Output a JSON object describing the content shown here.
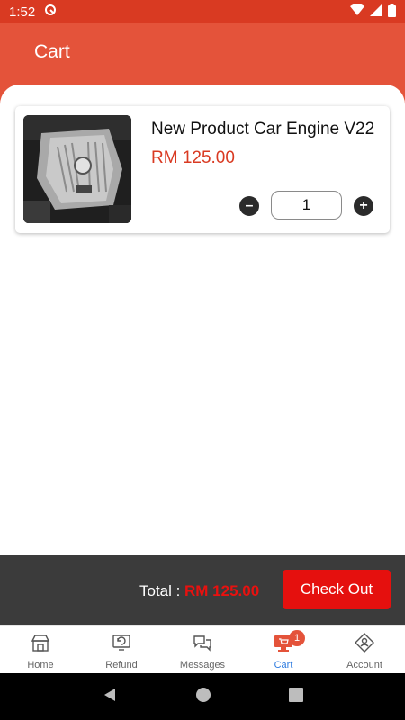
{
  "status_bar": {
    "time": "1:52"
  },
  "header": {
    "title": "Cart"
  },
  "cart": {
    "items": [
      {
        "name": "New Product Car Engine V22",
        "price": "RM 125.00",
        "quantity": "1"
      }
    ]
  },
  "checkout": {
    "total_label": "Total :",
    "total_value": "RM 125.00",
    "button_label": "Check Out"
  },
  "bottom_nav": {
    "items": [
      {
        "label": "Home",
        "icon": "store-icon"
      },
      {
        "label": "Refund",
        "icon": "refund-icon"
      },
      {
        "label": "Messages",
        "icon": "chat-icon"
      },
      {
        "label": "Cart",
        "icon": "cart-icon",
        "badge": "1",
        "active": true
      },
      {
        "label": "Account",
        "icon": "account-icon"
      }
    ]
  },
  "colors": {
    "status_bar": "#d93a22",
    "header": "#e4533a",
    "price": "#d93a22",
    "checkout_bar": "#3b3b3b",
    "checkout_button": "#e5100e",
    "active_nav": "#2d7be0"
  }
}
